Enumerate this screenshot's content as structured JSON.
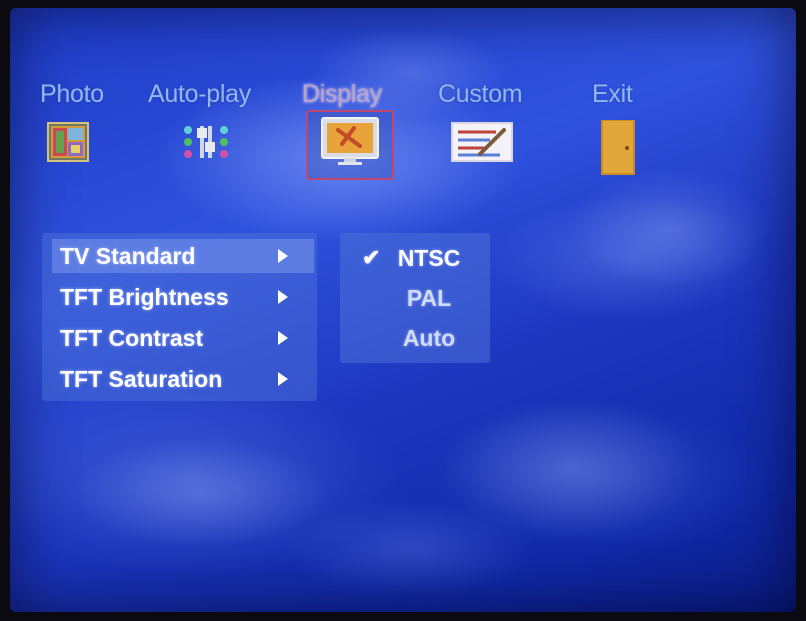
{
  "top_menu": {
    "items": [
      {
        "label": "Photo",
        "icon": "photo-icon"
      },
      {
        "label": "Auto-play",
        "icon": "auto-play-icon"
      },
      {
        "label": "Display",
        "icon": "display-icon",
        "active": true
      },
      {
        "label": "Custom",
        "icon": "custom-icon"
      },
      {
        "label": "Exit",
        "icon": "exit-door-icon"
      }
    ]
  },
  "settings_menu": {
    "items": [
      {
        "label": "TV Standard",
        "selected": true
      },
      {
        "label": "TFT Brightness"
      },
      {
        "label": "TFT Contrast"
      },
      {
        "label": "TFT Saturation"
      }
    ]
  },
  "tv_standard_options": {
    "items": [
      {
        "label": "NTSC",
        "checked": true
      },
      {
        "label": "PAL"
      },
      {
        "label": "Auto"
      }
    ],
    "check_mark": "✔"
  },
  "colors": {
    "background_blue": "#1f3cc8",
    "label_blue": "#8fb8f2",
    "active_frame": "#c04870",
    "text_white": "#ffffff"
  }
}
